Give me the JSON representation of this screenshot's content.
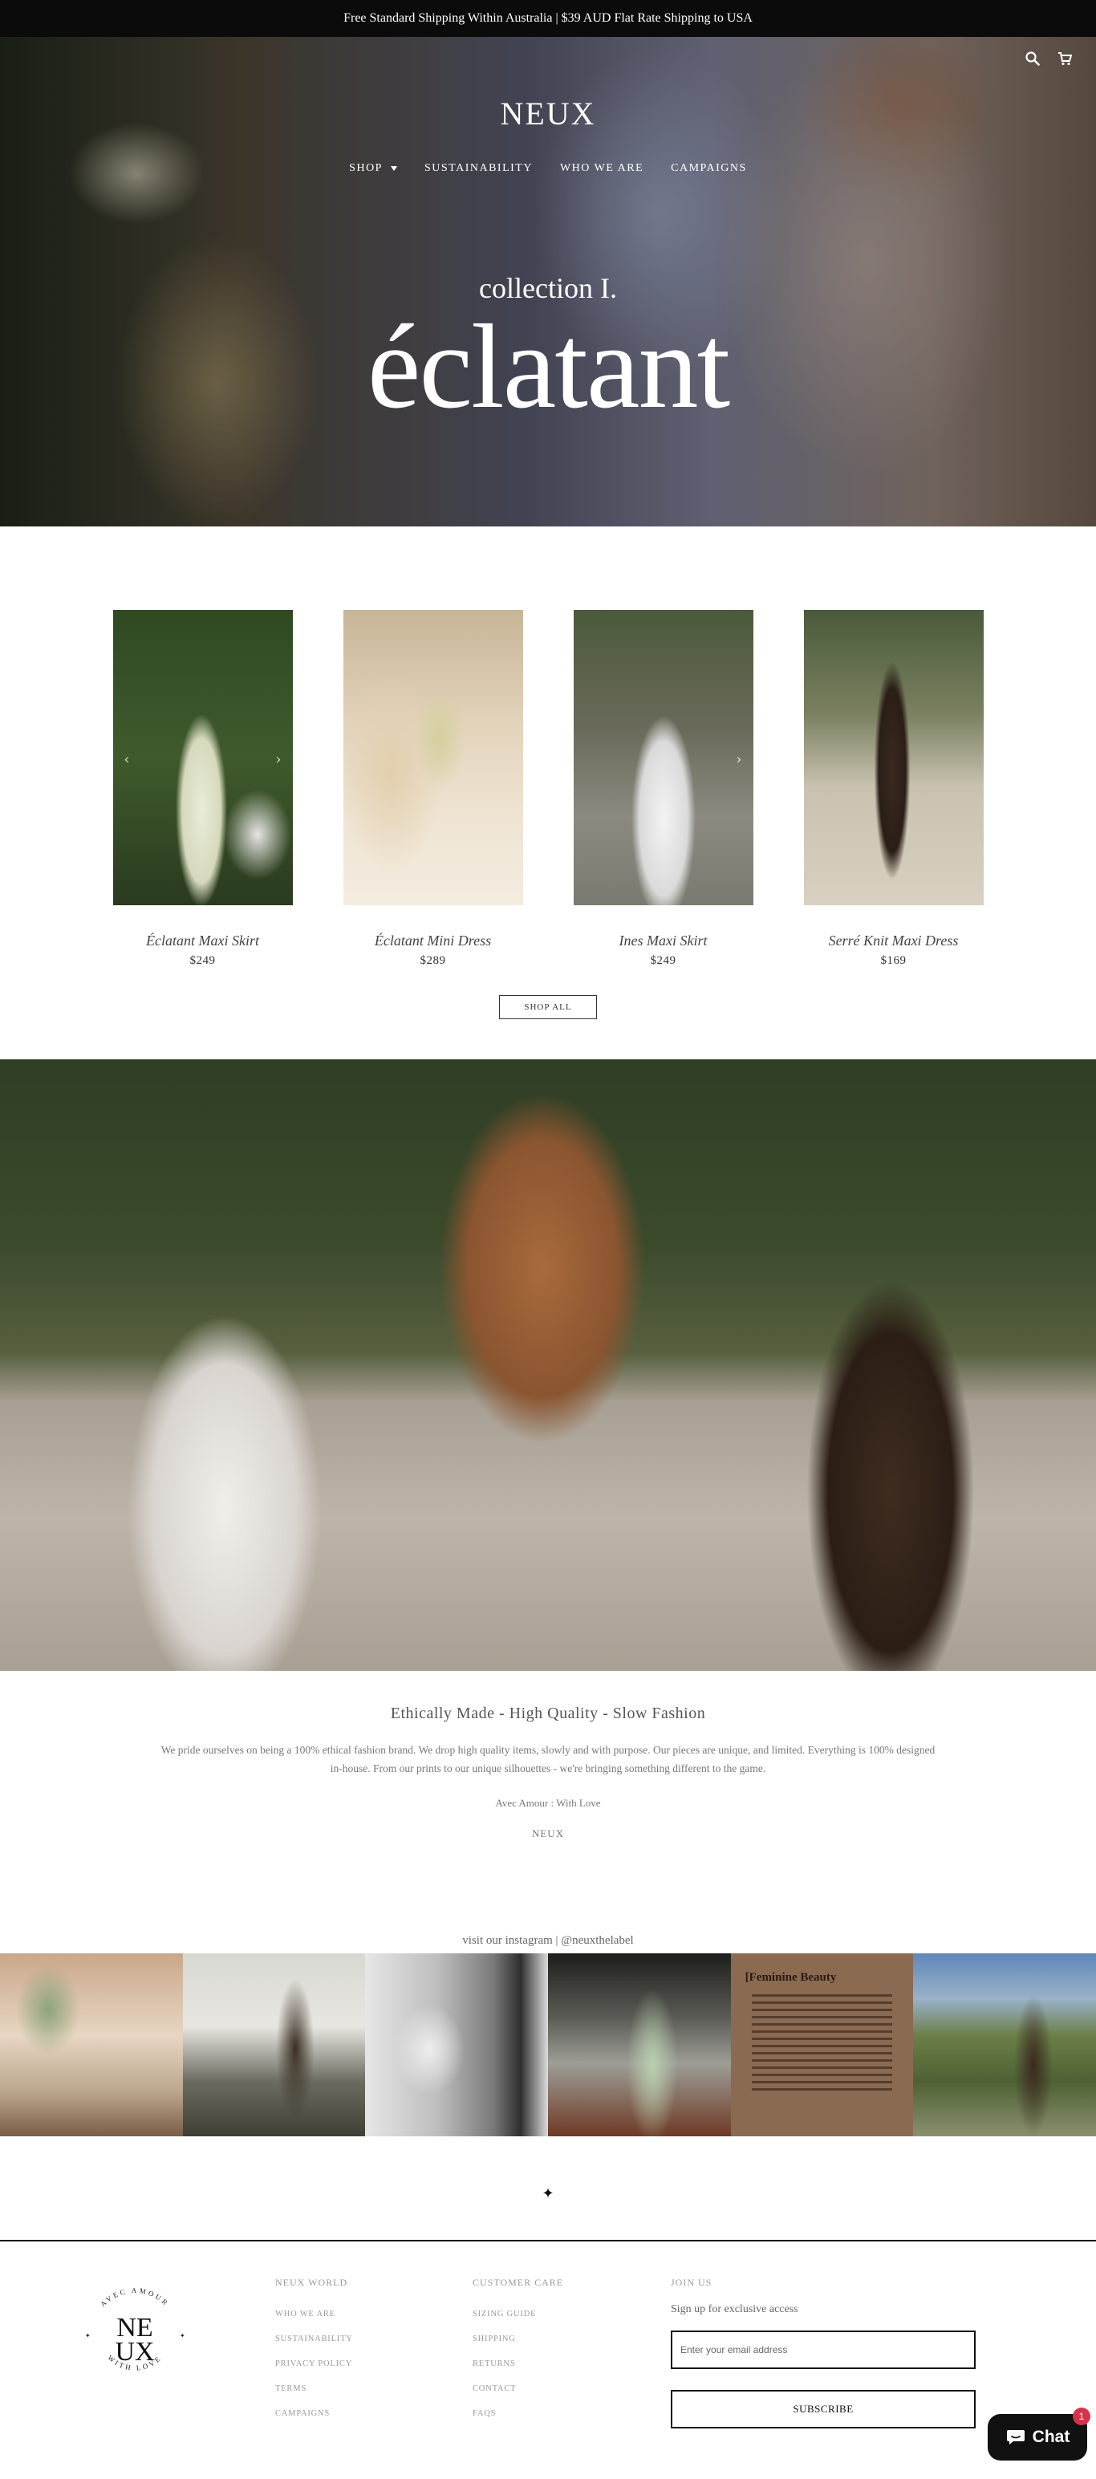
{
  "announcement": "Free Standard Shipping Within Australia | $39 AUD Flat Rate Shipping to USA",
  "header": {
    "logo": "NEUX",
    "nav": [
      "SHOP",
      "SUSTAINABILITY",
      "WHO WE ARE",
      "CAMPAIGNS"
    ],
    "icons": [
      "search-icon",
      "cart-icon"
    ]
  },
  "hero": {
    "subtitle": "collection I.",
    "title": "éclatant"
  },
  "products": [
    {
      "name": "Éclatant Maxi Skirt",
      "price": "$249"
    },
    {
      "name": "Éclatant Mini Dress",
      "price": "$289"
    },
    {
      "name": "Ines Maxi Skirt",
      "price": "$249"
    },
    {
      "name": "Serré Knit Maxi Dress",
      "price": "$169"
    }
  ],
  "shop_all": "SHOP ALL",
  "about": {
    "heading": "Ethically Made - High Quality - Slow Fashion",
    "body": "We pride ourselves on being a 100% ethical fashion brand. We drop high quality items, slowly and with purpose. Our pieces are unique, and limited. Everything is 100% designed in-house. From our prints to our unique silhouettes - we're bringing something different to the game.",
    "signoff": "Avec Amour : With Love",
    "brand": "NEUX"
  },
  "instagram": {
    "title": "visit our instagram | @neuxthelabel",
    "beauty_tile_title": "[Feminine Beauty"
  },
  "footer": {
    "logo": {
      "top": "AVEC AMOUR",
      "line1": "NE",
      "line2": "UX",
      "bottom": "WITH LOVE"
    },
    "world": {
      "title": "NEUX WORLD",
      "links": [
        "WHO WE ARE",
        "SUSTAINABILITY",
        "PRIVACY POLICY",
        "TERMS",
        "CAMPAIGNS"
      ]
    },
    "care": {
      "title": "CUSTOMER CARE",
      "links": [
        "SIZING GUIDE",
        "SHIPPING",
        "RETURNS",
        "CONTACT",
        "FAQS"
      ]
    },
    "join": {
      "title": "JOIN US",
      "tagline": "Sign up for exclusive access",
      "email_placeholder": "Enter your email address",
      "subscribe": "SUBSCRIBE"
    }
  },
  "chat": {
    "label": "Chat",
    "badge": "1"
  }
}
